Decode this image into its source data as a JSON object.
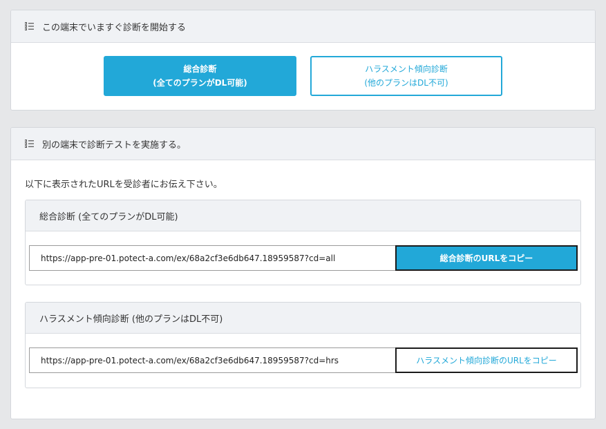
{
  "section_device": {
    "title": "この端末でいますぐ診断を開始する",
    "comprehensive_button": {
      "line1": "総合診断",
      "line2": "(全てのプランがDL可能)"
    },
    "harassment_button": {
      "line1": "ハラスメント傾向診断",
      "line2": "(他のプランはDL不可)"
    }
  },
  "section_other_device": {
    "title": "別の端末で診断テストを実施する。",
    "intro": "以下に表示されたURLを受診者にお伝え下さい。",
    "comprehensive": {
      "title": "総合診断 (全てのプランがDL可能)",
      "url": "https://app-pre-01.potect-a.com/ex/68a2cf3e6db647.18959587?cd=all",
      "copy_label": "総合診断のURLをコピー"
    },
    "harassment": {
      "title": "ハラスメント傾向診断 (他のプランはDL不可)",
      "url": "https://app-pre-01.potect-a.com/ex/68a2cf3e6db647.18959587?cd=hrs",
      "copy_label": "ハラスメント傾向診断のURLをコピー"
    }
  },
  "icons": {
    "section_icon": "list-icon"
  },
  "colors": {
    "accent": "#22a8d8",
    "header_bg": "#f0f2f5",
    "page_bg": "#e6e7e9"
  }
}
